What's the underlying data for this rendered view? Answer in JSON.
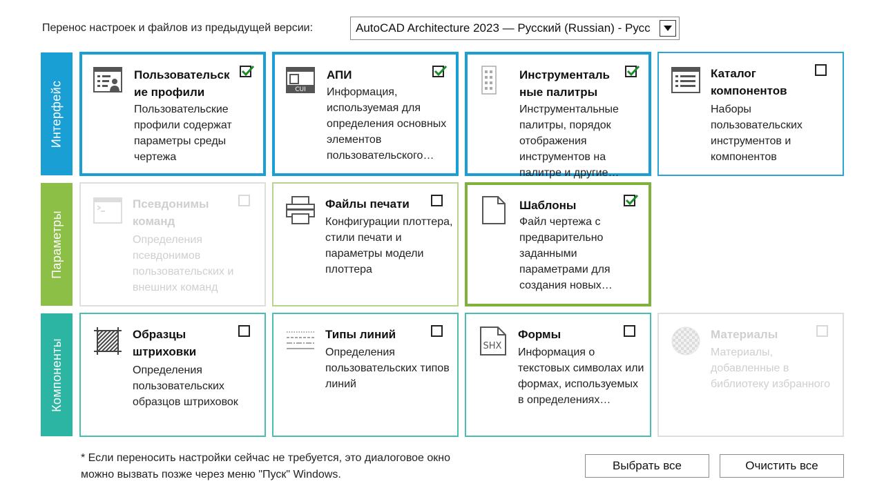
{
  "header": {
    "label": "Перенос настроек и файлов из предыдущей версии:",
    "select_value": "AutoCAD Architecture 2023 — Русский (Russian) - Русс"
  },
  "groups": [
    {
      "label": "Интерфейс",
      "color": "#1a9fd5"
    },
    {
      "label": "Параметры",
      "color": "#8bbf45"
    },
    {
      "label": "Компоненты",
      "color": "#2bb5a2"
    }
  ],
  "cards": [
    {
      "title": "Пользовательск ие профили",
      "desc": "Пользовательские профили содержат параметры среды чертежа",
      "checked": true,
      "icon": "user-profile-icon"
    },
    {
      "title": "АПИ",
      "desc": "Информация, используемая для определения основных элементов пользовательского…",
      "checked": true,
      "icon": "cui-icon"
    },
    {
      "title": "Инструменталь ные палитры",
      "desc": "Инструментальные палитры, порядок отображения инструментов на палитре и другие…",
      "checked": true,
      "icon": "tool-palette-icon"
    },
    {
      "title": "Каталог компонентов",
      "desc": "Наборы пользовательских инструментов и компонентов",
      "checked": false,
      "icon": "catalog-icon"
    },
    {
      "title": "Псевдонимы команд",
      "desc": "Определения псевдонимов пользовательских и внешних команд",
      "checked": false,
      "icon": "command-alias-icon"
    },
    {
      "title": "Файлы печати",
      "desc": "Конфигурации плоттера, стили печати и параметры модели плоттера",
      "checked": false,
      "icon": "printer-icon"
    },
    {
      "title": "Шаблоны",
      "desc": "Файл чертежа с предварительно заданными параметрами для создания новых…",
      "checked": true,
      "icon": "template-icon"
    },
    {
      "title": "Образцы штриховки",
      "desc": "Определения пользовательских образцов штриховок",
      "checked": false,
      "icon": "hatch-icon"
    },
    {
      "title": "Типы линий",
      "desc": "Определения пользовательских типов линий",
      "checked": false,
      "icon": "linetype-icon"
    },
    {
      "title": "Формы",
      "desc": "Информация о текстовых символах или формах, используемых в определениях…",
      "checked": false,
      "icon": "shx-icon"
    },
    {
      "title": "Материалы",
      "desc": "Материалы, добавленные в библиотеку избранного",
      "checked": false,
      "icon": "materials-icon"
    }
  ],
  "footer": {
    "note_line1": "* Если переносить настройки сейчас не требуется, это диалоговое окно",
    "note_line2": "можно вызвать позже через меню \"Пуск\" Windows.",
    "select_all": "Выбрать все",
    "clear_all": "Очистить все"
  }
}
